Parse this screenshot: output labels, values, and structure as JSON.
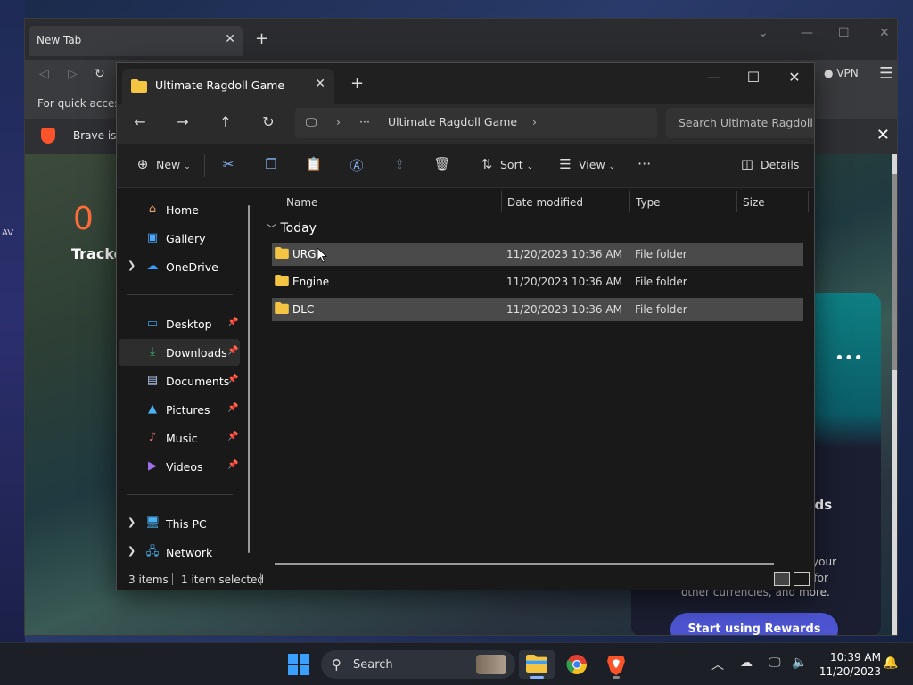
{
  "desktop": {
    "left_labels": [
      "AV"
    ]
  },
  "browser": {
    "tab_title": "New Tab",
    "bookmarks_hint": "For quick access,",
    "banner_text": "Brave isn",
    "vpn_label": "VPN",
    "tracker_count": "0",
    "trackers_label": "Tracke",
    "rewards": {
      "ads_text": "e ads",
      "desc_line1": "use your",
      "desc_line2": "nge for",
      "desc_line3": "other currencies, and more.",
      "button_label": "Start using Rewards"
    }
  },
  "explorer": {
    "tab_title": "Ultimate Ragdoll Game",
    "address": {
      "overflow": "···",
      "current": "Ultimate Ragdoll Game"
    },
    "search_placeholder": "Search Ultimate Ragdoll Game",
    "toolbar": {
      "new_label": "New",
      "sort_label": "Sort",
      "view_label": "View",
      "more_label": "···",
      "details_label": "Details"
    },
    "sidebar": {
      "home": "Home",
      "gallery": "Gallery",
      "onedrive": "OneDrive",
      "desktop": "Desktop",
      "downloads": "Downloads",
      "documents": "Documents",
      "pictures": "Pictures",
      "music": "Music",
      "videos": "Videos",
      "this_pc": "This PC",
      "network": "Network"
    },
    "columns": {
      "name": "Name",
      "date": "Date modified",
      "type": "Type",
      "size": "Size"
    },
    "group_label": "Today",
    "files": [
      {
        "name": "URG",
        "date": "11/20/2023 10:36 AM",
        "type": "File folder"
      },
      {
        "name": "Engine",
        "date": "11/20/2023 10:36 AM",
        "type": "File folder"
      },
      {
        "name": "DLC",
        "date": "11/20/2023 10:36 AM",
        "type": "File folder"
      }
    ],
    "status": {
      "count": "3 items",
      "selected": "1 item selected"
    }
  },
  "taskbar": {
    "search_label": "Search",
    "time": "10:39 AM",
    "date": "11/20/2023"
  },
  "colors": {
    "accent": "#8ab4f8",
    "folder": "#f4c542",
    "selection": "#4a4a4a"
  }
}
